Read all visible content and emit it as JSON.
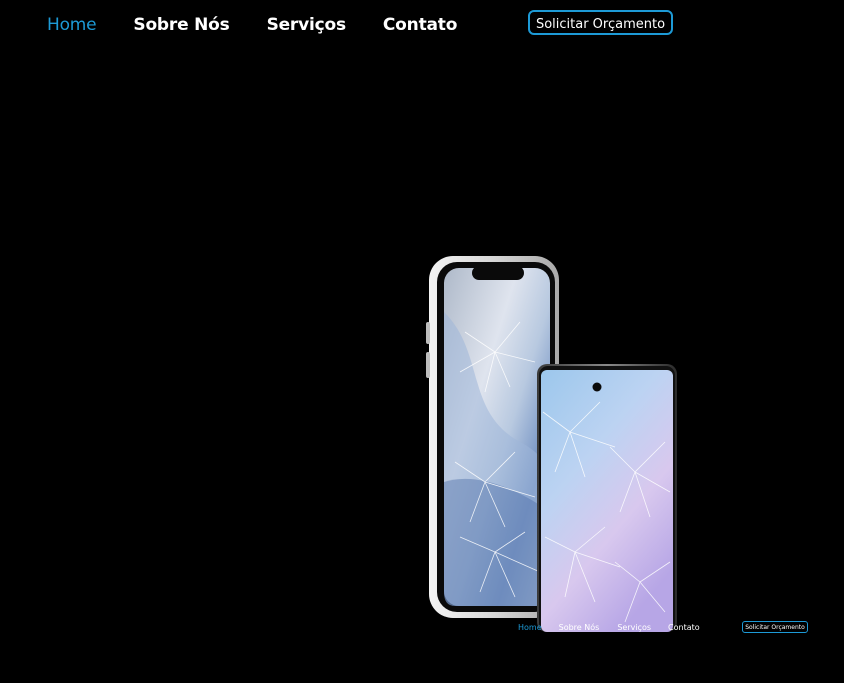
{
  "nav": {
    "items": [
      {
        "label": "Home",
        "active": true
      },
      {
        "label": "Sobre Nós",
        "active": false
      },
      {
        "label": "Serviços",
        "active": false
      },
      {
        "label": "Contato",
        "active": false
      }
    ],
    "cta_label": "Solicitar Orçamento"
  },
  "hero": {
    "image_alt": "cracked-screen-phones"
  },
  "mini_nav": {
    "items": [
      {
        "label": "Home",
        "active": true
      },
      {
        "label": "Sobre Nós",
        "active": false
      },
      {
        "label": "Serviços",
        "active": false
      },
      {
        "label": "Contato",
        "active": false
      }
    ],
    "cta_label": "Solicitar Orçamento"
  },
  "colors": {
    "background": "#000000",
    "accent": "#1d9ad6",
    "text": "#ffffff"
  }
}
